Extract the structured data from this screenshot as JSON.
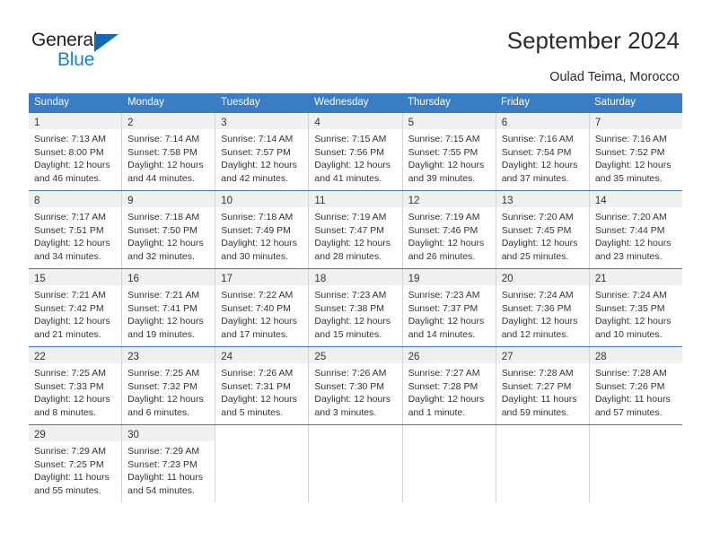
{
  "brand": {
    "name_part1": "General",
    "name_part2": "Blue",
    "triangle_color": "#1268b3",
    "blue_color": "#1c7fd4"
  },
  "header": {
    "title": "September 2024",
    "subtitle": "Oulad Teima, Morocco"
  },
  "calendar": {
    "header_bg": "#3b7dc4",
    "day_band_bg": "#f0f0f0",
    "weekdays": [
      "Sunday",
      "Monday",
      "Tuesday",
      "Wednesday",
      "Thursday",
      "Friday",
      "Saturday"
    ],
    "weeks": [
      [
        {
          "day": "1",
          "sunrise": "Sunrise: 7:13 AM",
          "sunset": "Sunset: 8:00 PM",
          "daylight1": "Daylight: 12 hours",
          "daylight2": "and 46 minutes."
        },
        {
          "day": "2",
          "sunrise": "Sunrise: 7:14 AM",
          "sunset": "Sunset: 7:58 PM",
          "daylight1": "Daylight: 12 hours",
          "daylight2": "and 44 minutes."
        },
        {
          "day": "3",
          "sunrise": "Sunrise: 7:14 AM",
          "sunset": "Sunset: 7:57 PM",
          "daylight1": "Daylight: 12 hours",
          "daylight2": "and 42 minutes."
        },
        {
          "day": "4",
          "sunrise": "Sunrise: 7:15 AM",
          "sunset": "Sunset: 7:56 PM",
          "daylight1": "Daylight: 12 hours",
          "daylight2": "and 41 minutes."
        },
        {
          "day": "5",
          "sunrise": "Sunrise: 7:15 AM",
          "sunset": "Sunset: 7:55 PM",
          "daylight1": "Daylight: 12 hours",
          "daylight2": "and 39 minutes."
        },
        {
          "day": "6",
          "sunrise": "Sunrise: 7:16 AM",
          "sunset": "Sunset: 7:54 PM",
          "daylight1": "Daylight: 12 hours",
          "daylight2": "and 37 minutes."
        },
        {
          "day": "7",
          "sunrise": "Sunrise: 7:16 AM",
          "sunset": "Sunset: 7:52 PM",
          "daylight1": "Daylight: 12 hours",
          "daylight2": "and 35 minutes."
        }
      ],
      [
        {
          "day": "8",
          "sunrise": "Sunrise: 7:17 AM",
          "sunset": "Sunset: 7:51 PM",
          "daylight1": "Daylight: 12 hours",
          "daylight2": "and 34 minutes."
        },
        {
          "day": "9",
          "sunrise": "Sunrise: 7:18 AM",
          "sunset": "Sunset: 7:50 PM",
          "daylight1": "Daylight: 12 hours",
          "daylight2": "and 32 minutes."
        },
        {
          "day": "10",
          "sunrise": "Sunrise: 7:18 AM",
          "sunset": "Sunset: 7:49 PM",
          "daylight1": "Daylight: 12 hours",
          "daylight2": "and 30 minutes."
        },
        {
          "day": "11",
          "sunrise": "Sunrise: 7:19 AM",
          "sunset": "Sunset: 7:47 PM",
          "daylight1": "Daylight: 12 hours",
          "daylight2": "and 28 minutes."
        },
        {
          "day": "12",
          "sunrise": "Sunrise: 7:19 AM",
          "sunset": "Sunset: 7:46 PM",
          "daylight1": "Daylight: 12 hours",
          "daylight2": "and 26 minutes."
        },
        {
          "day": "13",
          "sunrise": "Sunrise: 7:20 AM",
          "sunset": "Sunset: 7:45 PM",
          "daylight1": "Daylight: 12 hours",
          "daylight2": "and 25 minutes."
        },
        {
          "day": "14",
          "sunrise": "Sunrise: 7:20 AM",
          "sunset": "Sunset: 7:44 PM",
          "daylight1": "Daylight: 12 hours",
          "daylight2": "and 23 minutes."
        }
      ],
      [
        {
          "day": "15",
          "sunrise": "Sunrise: 7:21 AM",
          "sunset": "Sunset: 7:42 PM",
          "daylight1": "Daylight: 12 hours",
          "daylight2": "and 21 minutes."
        },
        {
          "day": "16",
          "sunrise": "Sunrise: 7:21 AM",
          "sunset": "Sunset: 7:41 PM",
          "daylight1": "Daylight: 12 hours",
          "daylight2": "and 19 minutes."
        },
        {
          "day": "17",
          "sunrise": "Sunrise: 7:22 AM",
          "sunset": "Sunset: 7:40 PM",
          "daylight1": "Daylight: 12 hours",
          "daylight2": "and 17 minutes."
        },
        {
          "day": "18",
          "sunrise": "Sunrise: 7:23 AM",
          "sunset": "Sunset: 7:38 PM",
          "daylight1": "Daylight: 12 hours",
          "daylight2": "and 15 minutes."
        },
        {
          "day": "19",
          "sunrise": "Sunrise: 7:23 AM",
          "sunset": "Sunset: 7:37 PM",
          "daylight1": "Daylight: 12 hours",
          "daylight2": "and 14 minutes."
        },
        {
          "day": "20",
          "sunrise": "Sunrise: 7:24 AM",
          "sunset": "Sunset: 7:36 PM",
          "daylight1": "Daylight: 12 hours",
          "daylight2": "and 12 minutes."
        },
        {
          "day": "21",
          "sunrise": "Sunrise: 7:24 AM",
          "sunset": "Sunset: 7:35 PM",
          "daylight1": "Daylight: 12 hours",
          "daylight2": "and 10 minutes."
        }
      ],
      [
        {
          "day": "22",
          "sunrise": "Sunrise: 7:25 AM",
          "sunset": "Sunset: 7:33 PM",
          "daylight1": "Daylight: 12 hours",
          "daylight2": "and 8 minutes."
        },
        {
          "day": "23",
          "sunrise": "Sunrise: 7:25 AM",
          "sunset": "Sunset: 7:32 PM",
          "daylight1": "Daylight: 12 hours",
          "daylight2": "and 6 minutes."
        },
        {
          "day": "24",
          "sunrise": "Sunrise: 7:26 AM",
          "sunset": "Sunset: 7:31 PM",
          "daylight1": "Daylight: 12 hours",
          "daylight2": "and 5 minutes."
        },
        {
          "day": "25",
          "sunrise": "Sunrise: 7:26 AM",
          "sunset": "Sunset: 7:30 PM",
          "daylight1": "Daylight: 12 hours",
          "daylight2": "and 3 minutes."
        },
        {
          "day": "26",
          "sunrise": "Sunrise: 7:27 AM",
          "sunset": "Sunset: 7:28 PM",
          "daylight1": "Daylight: 12 hours",
          "daylight2": "and 1 minute."
        },
        {
          "day": "27",
          "sunrise": "Sunrise: 7:28 AM",
          "sunset": "Sunset: 7:27 PM",
          "daylight1": "Daylight: 11 hours",
          "daylight2": "and 59 minutes."
        },
        {
          "day": "28",
          "sunrise": "Sunrise: 7:28 AM",
          "sunset": "Sunset: 7:26 PM",
          "daylight1": "Daylight: 11 hours",
          "daylight2": "and 57 minutes."
        }
      ],
      [
        {
          "day": "29",
          "sunrise": "Sunrise: 7:29 AM",
          "sunset": "Sunset: 7:25 PM",
          "daylight1": "Daylight: 11 hours",
          "daylight2": "and 55 minutes."
        },
        {
          "day": "30",
          "sunrise": "Sunrise: 7:29 AM",
          "sunset": "Sunset: 7:23 PM",
          "daylight1": "Daylight: 11 hours",
          "daylight2": "and 54 minutes."
        },
        {
          "day": "",
          "sunrise": "",
          "sunset": "",
          "daylight1": "",
          "daylight2": ""
        },
        {
          "day": "",
          "sunrise": "",
          "sunset": "",
          "daylight1": "",
          "daylight2": ""
        },
        {
          "day": "",
          "sunrise": "",
          "sunset": "",
          "daylight1": "",
          "daylight2": ""
        },
        {
          "day": "",
          "sunrise": "",
          "sunset": "",
          "daylight1": "",
          "daylight2": ""
        },
        {
          "day": "",
          "sunrise": "",
          "sunset": "",
          "daylight1": "",
          "daylight2": ""
        }
      ]
    ]
  }
}
